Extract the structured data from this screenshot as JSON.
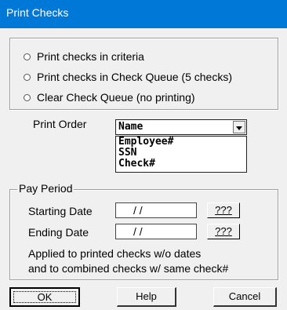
{
  "window": {
    "title": "Print Checks"
  },
  "print_options": {
    "items": [
      {
        "label": "Print checks in criteria"
      },
      {
        "label": "Print checks in Check Queue (5 checks)"
      },
      {
        "label": "Clear Check Queue (no printing)"
      }
    ]
  },
  "print_order": {
    "label": "Print Order",
    "selected": "Name",
    "options": [
      "Employee#",
      "SSN",
      "Check#"
    ]
  },
  "pay_period": {
    "legend": "Pay Period",
    "starting_label": "Starting Date",
    "starting_value": "/ /",
    "ending_label": "Ending Date",
    "ending_value": "/ /",
    "lookup_label": "???",
    "note_line1": "Applied to printed checks w/o dates",
    "note_line2": "and to combined checks w/ same check#"
  },
  "buttons": {
    "ok": "OK",
    "help": "Help",
    "cancel": "Cancel"
  }
}
